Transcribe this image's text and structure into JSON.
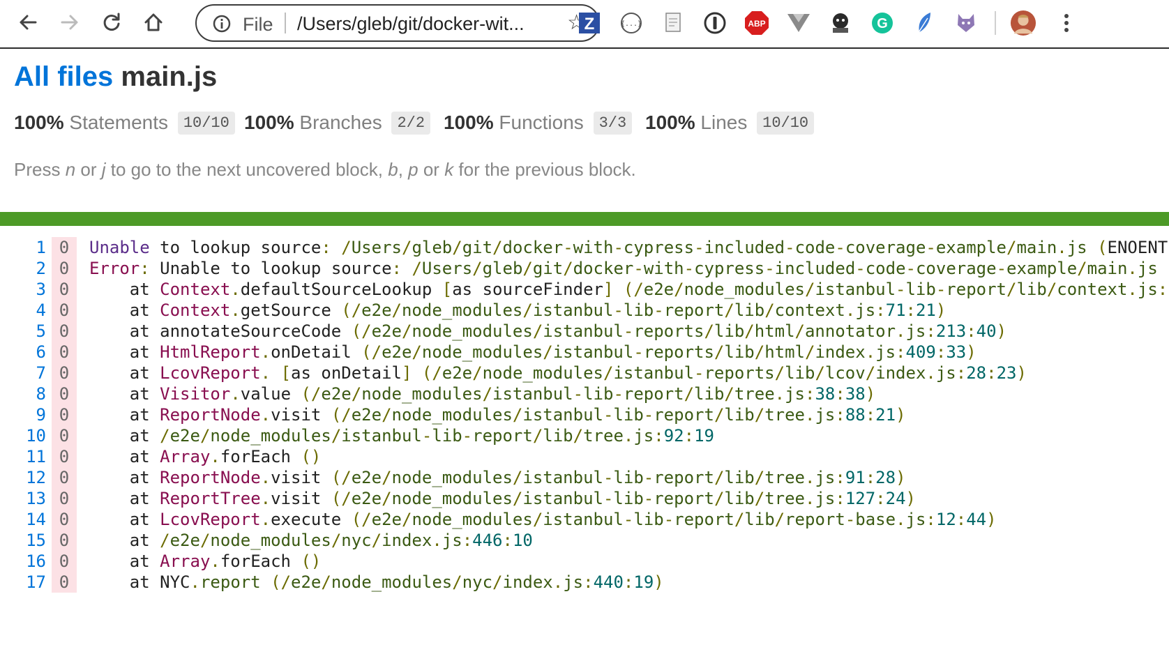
{
  "browser": {
    "back_icon": "arrow-left-icon",
    "forward_icon": "arrow-right-icon",
    "reload_icon": "reload-icon",
    "home_icon": "home-icon",
    "address": {
      "scheme_label": "File",
      "url": "/Users/gleb/git/docker-wit...",
      "info_icon": "info-icon",
      "bookmark_icon": "star-icon"
    },
    "extensions": [
      {
        "name": "zotero-icon",
        "text": "Z"
      },
      {
        "name": "json-viewer-icon",
        "text": "{...}"
      },
      {
        "name": "document-extension-icon",
        "text": ""
      },
      {
        "name": "onepassword-icon",
        "text": "1"
      },
      {
        "name": "adblock-plus-icon",
        "text": "ABP"
      },
      {
        "name": "vue-devtools-icon",
        "text": ""
      },
      {
        "name": "docker-extension-icon",
        "text": ""
      },
      {
        "name": "grammarly-icon",
        "text": "G"
      },
      {
        "name": "feather-extension-icon",
        "text": ""
      },
      {
        "name": "github-cat-icon",
        "text": ""
      }
    ],
    "profile_icon": "avatar-icon",
    "menu_icon": "kebab-menu-icon"
  },
  "header": {
    "all_files_link": "All files",
    "file_name": "main.js"
  },
  "summary": [
    {
      "pct": "100%",
      "label": "Statements",
      "fraction": "10/10"
    },
    {
      "pct": "100%",
      "label": "Branches",
      "fraction": "2/2"
    },
    {
      "pct": "100%",
      "label": "Functions",
      "fraction": "3/3"
    },
    {
      "pct": "100%",
      "label": "Lines",
      "fraction": "10/10"
    }
  ],
  "hint": {
    "p1": "Press ",
    "k1": "n",
    "p2": " or ",
    "k2": "j",
    "p3": " to go to the next uncovered block, ",
    "k3": "b",
    "p4": ", ",
    "k4": "p",
    "p5": " or ",
    "k5": "k",
    "p6": " for the previous block."
  },
  "colors": {
    "link": "#0074d9",
    "coverage_bar": "#4d9a27",
    "uncovered_bg": "#fce1e5"
  },
  "code_lines": [
    {
      "n": "1",
      "hits": "0",
      "text": "Unable to lookup source: /Users/gleb/git/docker-with-cypress-included-code-coverage-example/main.js (ENOENT"
    },
    {
      "n": "2",
      "hits": "0",
      "text": "Error: Unable to lookup source: /Users/gleb/git/docker-with-cypress-included-code-coverage-example/main.js"
    },
    {
      "n": "3",
      "hits": "0",
      "text": "    at Context.defaultSourceLookup [as sourceFinder] (/e2e/node_modules/istanbul-lib-report/lib/context.js:"
    },
    {
      "n": "4",
      "hits": "0",
      "text": "    at Context.getSource (/e2e/node_modules/istanbul-lib-report/lib/context.js:71:21)"
    },
    {
      "n": "5",
      "hits": "0",
      "text": "    at annotateSourceCode (/e2e/node_modules/istanbul-reports/lib/html/annotator.js:213:40)"
    },
    {
      "n": "6",
      "hits": "0",
      "text": "    at HtmlReport.onDetail (/e2e/node_modules/istanbul-reports/lib/html/index.js:409:33)"
    },
    {
      "n": "7",
      "hits": "0",
      "text": "    at LcovReport. [as onDetail] (/e2e/node_modules/istanbul-reports/lib/lcov/index.js:28:23)"
    },
    {
      "n": "8",
      "hits": "0",
      "text": "    at Visitor.value (/e2e/node_modules/istanbul-lib-report/lib/tree.js:38:38)"
    },
    {
      "n": "9",
      "hits": "0",
      "text": "    at ReportNode.visit (/e2e/node_modules/istanbul-lib-report/lib/tree.js:88:21)"
    },
    {
      "n": "10",
      "hits": "0",
      "text": "    at /e2e/node_modules/istanbul-lib-report/lib/tree.js:92:19"
    },
    {
      "n": "11",
      "hits": "0",
      "text": "    at Array.forEach ()"
    },
    {
      "n": "12",
      "hits": "0",
      "text": "    at ReportNode.visit (/e2e/node_modules/istanbul-lib-report/lib/tree.js:91:28)"
    },
    {
      "n": "13",
      "hits": "0",
      "text": "    at ReportTree.visit (/e2e/node_modules/istanbul-lib-report/lib/tree.js:127:24)"
    },
    {
      "n": "14",
      "hits": "0",
      "text": "    at LcovReport.execute (/e2e/node_modules/istanbul-lib-report/lib/report-base.js:12:44)"
    },
    {
      "n": "15",
      "hits": "0",
      "text": "    at /e2e/node_modules/nyc/index.js:446:10"
    },
    {
      "n": "16",
      "hits": "0",
      "text": "    at Array.forEach ()"
    },
    {
      "n": "17",
      "hits": "0",
      "text": "    at NYC.report (/e2e/node_modules/nyc/index.js:440:19)"
    }
  ]
}
